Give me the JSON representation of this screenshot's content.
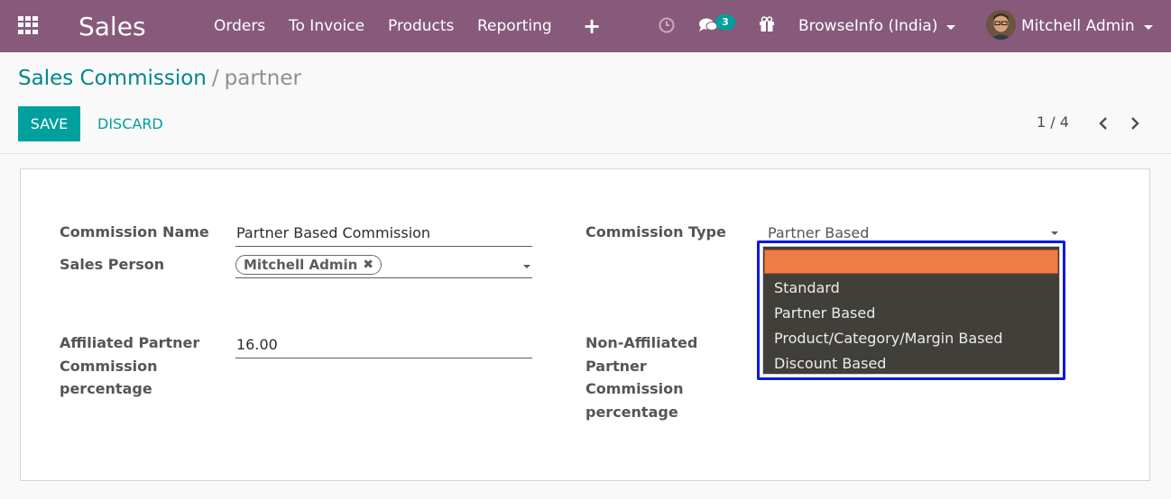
{
  "navbar": {
    "app_name": "Sales",
    "menu": [
      "Orders",
      "To Invoice",
      "Products",
      "Reporting",
      "+"
    ],
    "messages_count": "3",
    "company": "BrowseInfo (India)",
    "user": "Mitchell Admin",
    "color": "#875a7b"
  },
  "breadcrumb": {
    "parent": "Sales Commission",
    "separator": "/",
    "current": "partner"
  },
  "toolbar": {
    "save_label": "SAVE",
    "discard_label": "DISCARD",
    "accent": "#00a09d"
  },
  "pager": {
    "value": "1 / 4"
  },
  "form": {
    "commission_name": {
      "label": "Commission Name",
      "value": "Partner Based Commission"
    },
    "sales_person": {
      "label": "Sales Person",
      "tag": "Mitchell Admin"
    },
    "affiliated": {
      "label_lines": [
        "Affiliated Partner",
        "Commission",
        "percentage"
      ],
      "value": "16.00"
    },
    "commission_type": {
      "label": "Commission Type",
      "value": "Partner Based"
    },
    "non_affiliated": {
      "label_lines": [
        "Non-Affiliated",
        "Partner",
        "Commission",
        "percentage"
      ]
    }
  },
  "dropdown": {
    "options": [
      "",
      "Standard",
      "Partner Based",
      "Product/Category/Margin Based",
      "Discount Based"
    ],
    "highlight_color": "#ed7c47",
    "focus_border_color": "#0a17e8"
  },
  "icons": {
    "apps": "apps-grid-icon",
    "activity": "clock-icon",
    "messages": "chat-icon",
    "gift": "gift-icon",
    "prev": "chevron-left-icon",
    "next": "chevron-right-icon"
  }
}
